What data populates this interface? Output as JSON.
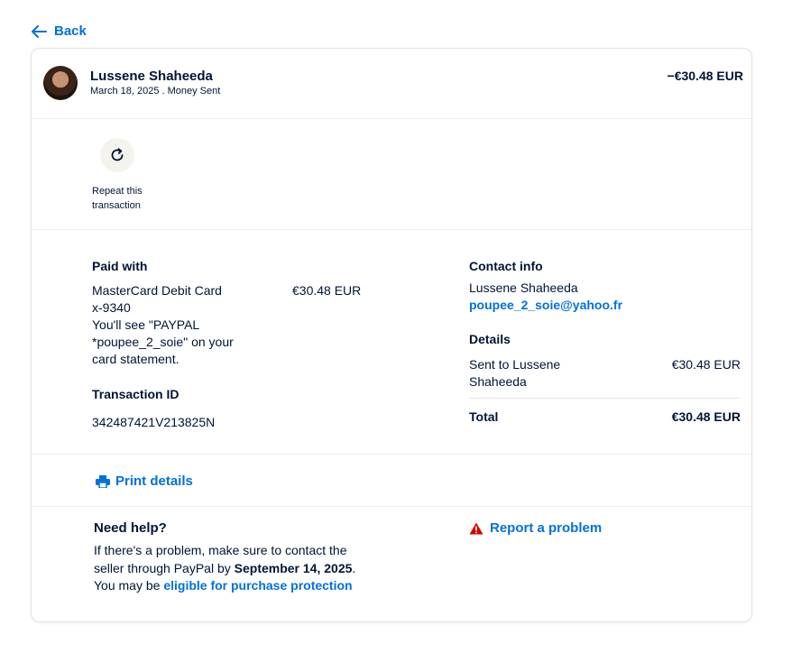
{
  "nav": {
    "back_label": "Back"
  },
  "header": {
    "name": "Lussene Shaheeda",
    "subtitle": "March 18, 2025 . Money Sent",
    "amount": "−€30.48 EUR"
  },
  "actions": {
    "repeat_label": "Repeat this transaction"
  },
  "payment": {
    "heading": "Paid with",
    "method": "MasterCard Debit Card",
    "card_suffix": "x-9340",
    "statement_note": "You'll see \"PAYPAL *poupee_2_soie\" on your card statement.",
    "amount": "€30.48 EUR"
  },
  "transaction": {
    "heading": "Transaction ID",
    "id": "342487421V213825N"
  },
  "contact": {
    "heading": "Contact info",
    "name": "Lussene Shaheeda",
    "email": "poupee_2_soie@yahoo.fr"
  },
  "details": {
    "heading": "Details",
    "line_label": "Sent to Lussene Shaheeda",
    "line_amount": "€30.48 EUR",
    "total_label": "Total",
    "total_amount": "€30.48 EUR"
  },
  "print": {
    "label": "Print details"
  },
  "help": {
    "heading": "Need help?",
    "text_1": "If there's a problem, make sure to contact the seller through PayPal by ",
    "deadline": "September 14, 2025",
    "text_2": ". You may be ",
    "link": "eligible for purchase protection"
  },
  "report": {
    "label": "Report a problem"
  },
  "colors": {
    "accent": "#0070e0",
    "text": "#001435",
    "warning": "#d20000"
  }
}
